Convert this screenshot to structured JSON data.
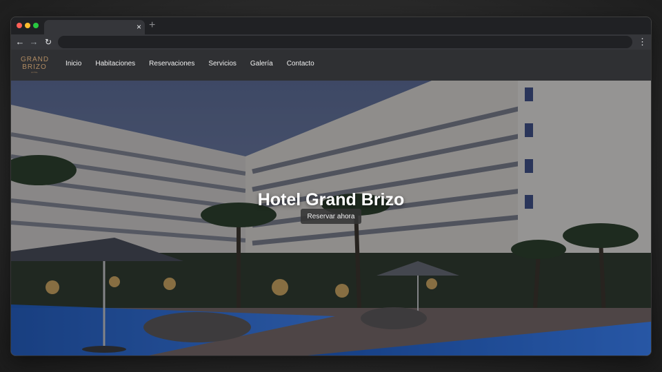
{
  "browser": {
    "tab_title": "",
    "tab_close_icon": "close-icon",
    "new_tab_icon": "plus-icon",
    "address_value": "",
    "nav_icons": [
      "back-arrow-icon",
      "forward-arrow-icon",
      "reload-icon",
      "kebab-menu-icon"
    ],
    "traffic_light_colors": [
      "#ff5f57",
      "#febc2e",
      "#28c840"
    ]
  },
  "site": {
    "logo": {
      "line1": "GRAND",
      "line2": "BRIZO",
      "sub": "HOTEL",
      "color": "#b08b62"
    },
    "nav": [
      {
        "label": "Inicio"
      },
      {
        "label": "Habitaciones"
      },
      {
        "label": "Reservaciones"
      },
      {
        "label": "Servicios"
      },
      {
        "label": "Galería"
      },
      {
        "label": "Contacto"
      }
    ],
    "hero": {
      "title": "Hotel Grand Brizo",
      "cta_label": "Reservar ahora"
    }
  },
  "colors": {
    "navbar_bg": "#2f3033",
    "cta_bg": "#343434",
    "pool": "#2f6fd8"
  }
}
